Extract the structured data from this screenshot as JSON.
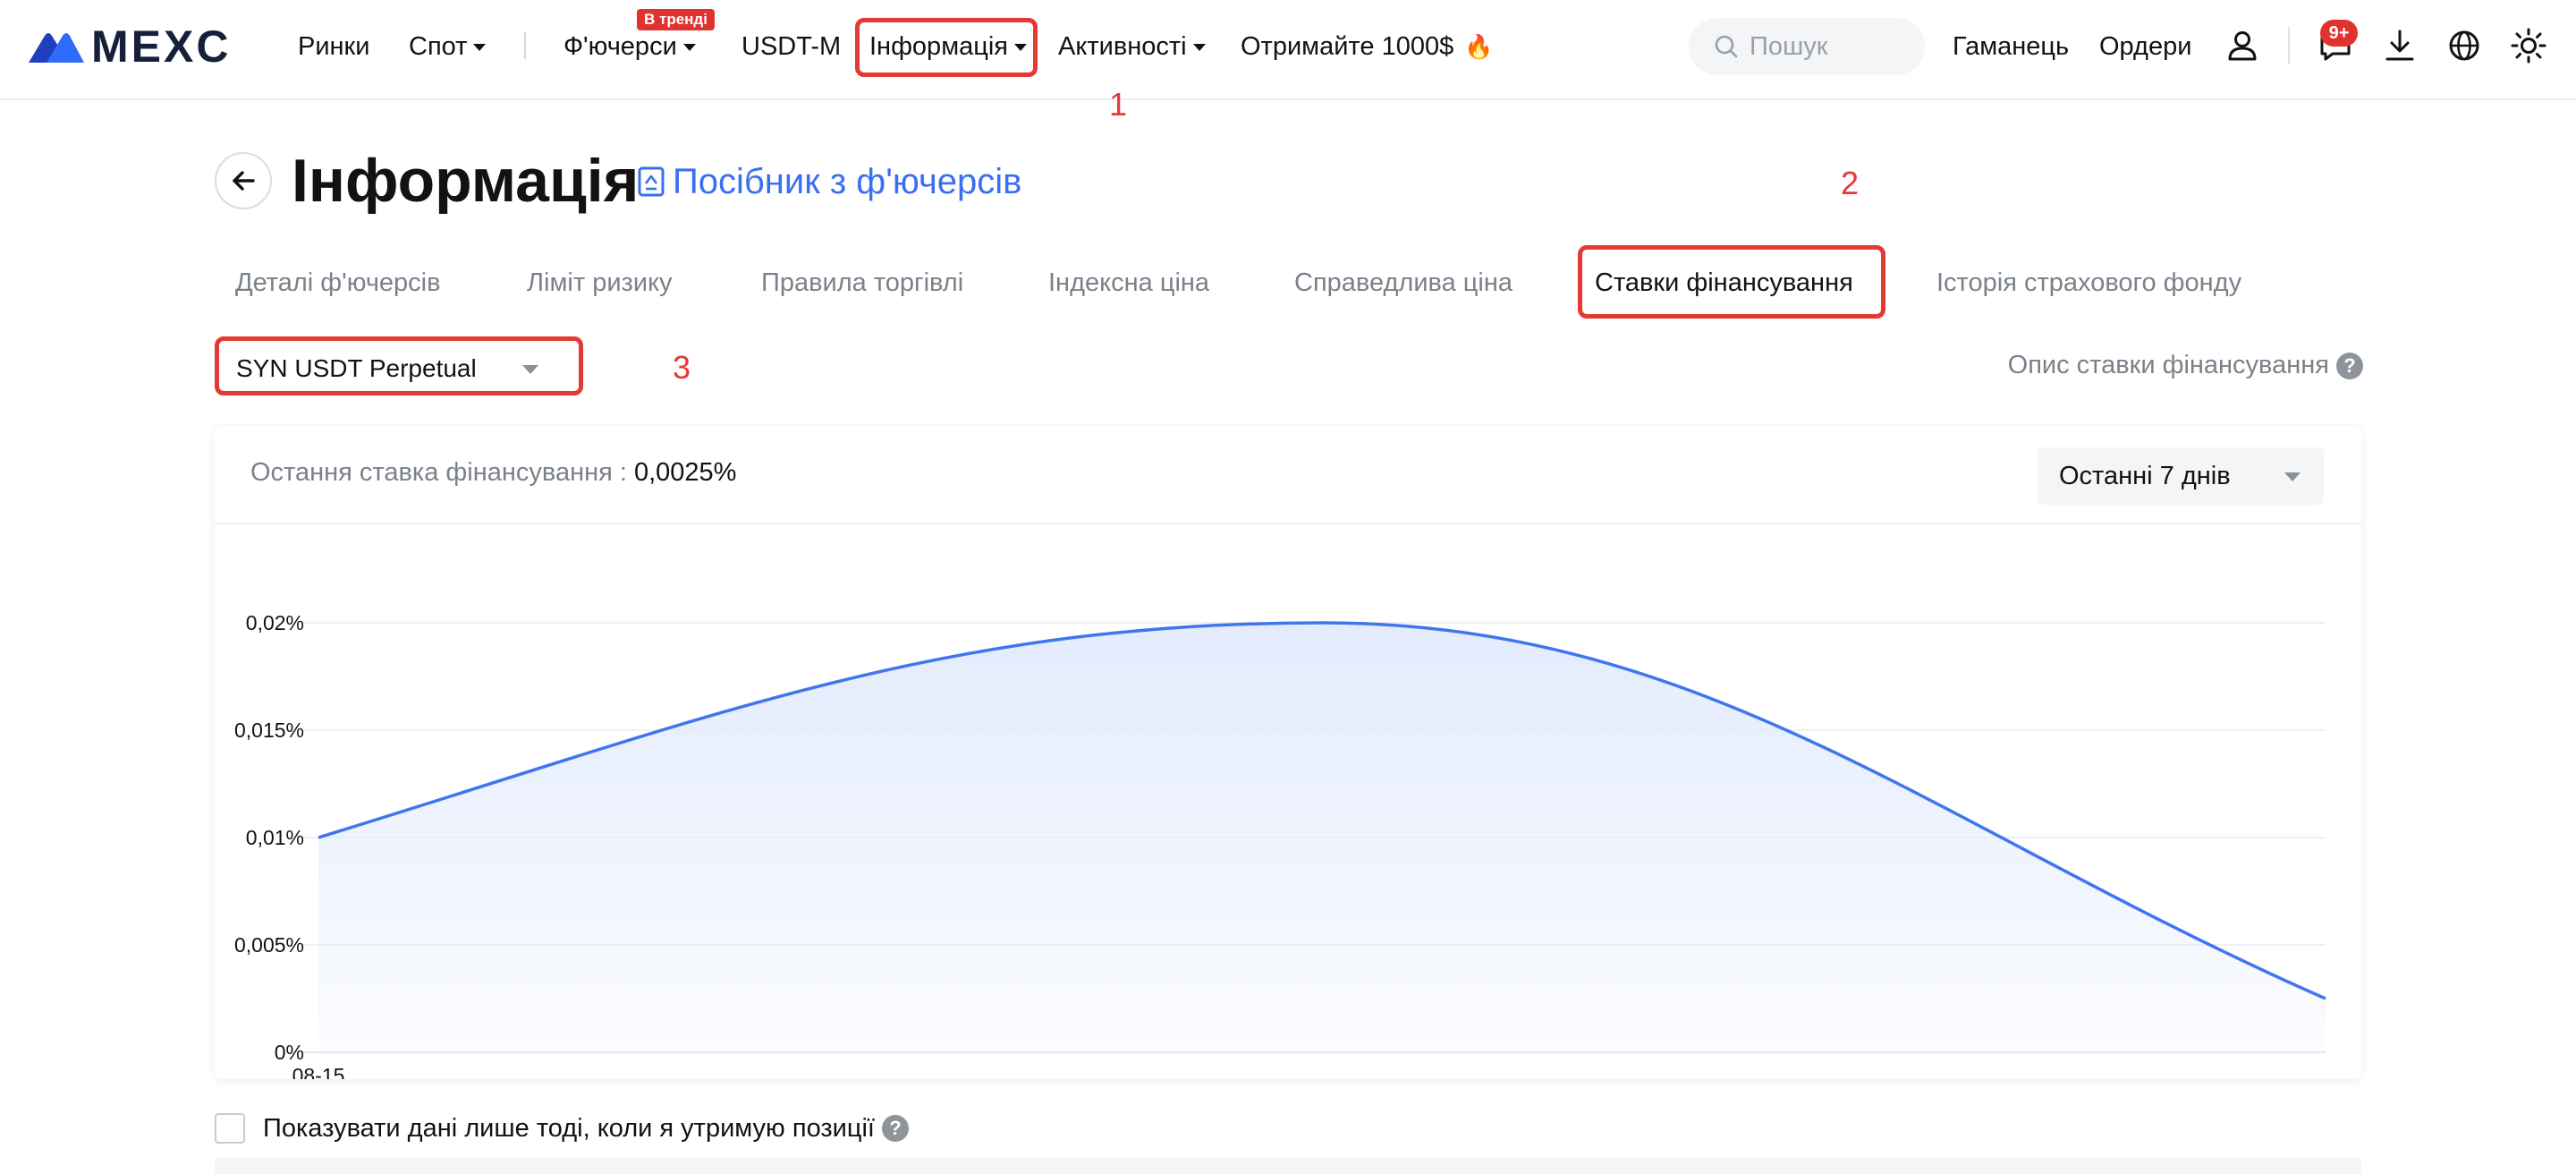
{
  "brand": {
    "name": "MEXC"
  },
  "nav": {
    "markets": "Ринки",
    "spot": "Спот",
    "futures": "Ф'ючерси",
    "futures_badge": "В тренді",
    "usdtm": "USDT-M",
    "info": "Інформація",
    "activities": "Активності",
    "promo": "Отримайте 1000$"
  },
  "search": {
    "placeholder": "Пошук"
  },
  "header_right": {
    "wallet": "Гаманець",
    "orders": "Ордери",
    "notif_count": "9+"
  },
  "annotations": [
    "1",
    "2",
    "3"
  ],
  "page": {
    "title": "Інформація",
    "guide_link": "Посібник з ф'ючерсів"
  },
  "tabs": [
    {
      "label": "Деталі ф'ючерсів",
      "active": false
    },
    {
      "label": "Ліміт ризику",
      "active": false
    },
    {
      "label": "Правила торгівлі",
      "active": false
    },
    {
      "label": "Індексна ціна",
      "active": false
    },
    {
      "label": "Справедлива ціна",
      "active": false
    },
    {
      "label": "Ставки фінансування",
      "active": true
    },
    {
      "label": "Історія страхового фонду",
      "active": false
    }
  ],
  "contract": {
    "selected": "SYN USDT Perpetual"
  },
  "funding_desc": "Опис ставки фінансування",
  "card": {
    "last_rate_label": "Остання ставка фінансування :",
    "last_rate_value": "0,0025%",
    "period": "Останні 7 днів"
  },
  "chart_data": {
    "type": "area",
    "x": [
      "08-15",
      "",
      ""
    ],
    "x_tick_labels": [
      "08-15"
    ],
    "values": [
      0.01,
      0.02,
      0.0025
    ],
    "ylim": [
      0,
      0.02
    ],
    "y_ticks": [
      0,
      0.005,
      0.01,
      0.015,
      0.02
    ],
    "y_tick_labels": [
      "0%",
      "0,005%",
      "0,01%",
      "0,015%",
      "0,02%"
    ],
    "grid": true,
    "line_color": "#3f76ee",
    "fill_color": "#e3ebfd"
  },
  "only_positions": "Показувати дані лише тоді, коли я утримую позиції",
  "colors": {
    "accent": "#3a6ff2",
    "annotation": "#e53935",
    "badge": "#e0322f"
  }
}
